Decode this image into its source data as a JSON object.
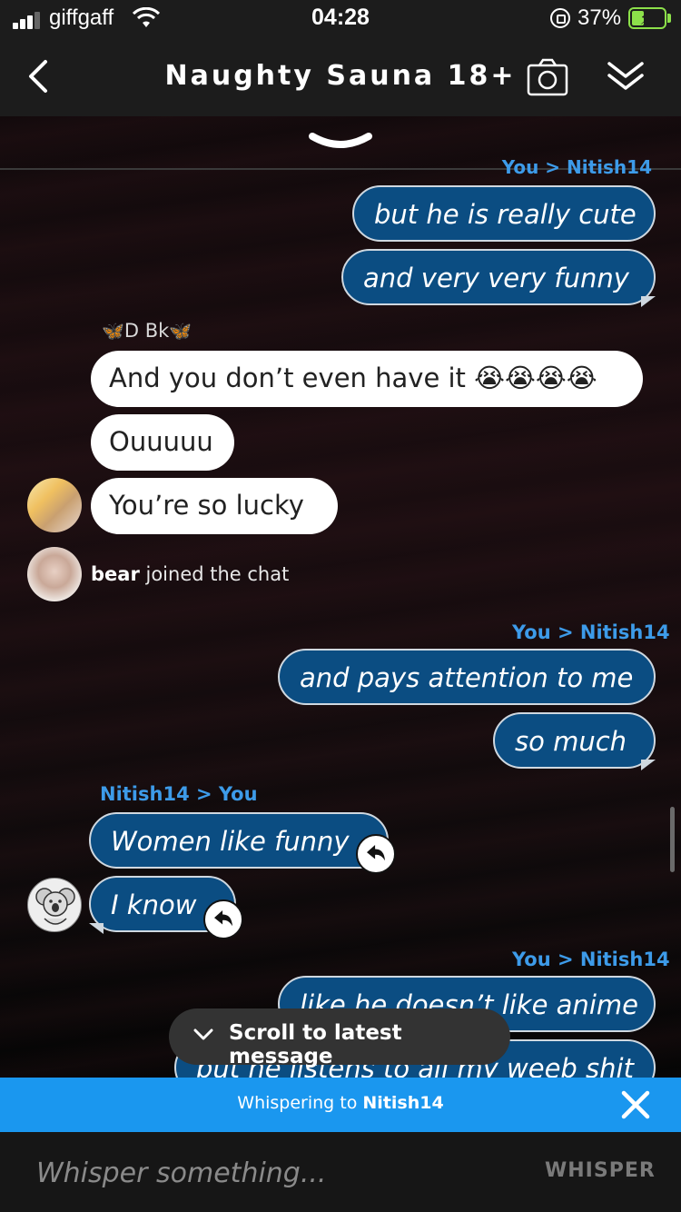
{
  "status_bar": {
    "carrier": "giffgaff",
    "time": "04:28",
    "battery_pct": "37%",
    "battery_level": 0.37
  },
  "header": {
    "title": "Naughty Sauna 18+",
    "back_icon": "chevron-left-icon",
    "camera_icon": "camera-icon",
    "collapse_icon": "double-chevron-down-icon"
  },
  "chat": {
    "cut_off_label": "You > Nitish14",
    "messages": [
      {
        "text": "but he is really cute"
      },
      {
        "text": "and very very funny"
      },
      {
        "sender": "D Bk",
        "text": "And you don’t even have it 😭😭😭😭"
      },
      {
        "text": "Ouuuuu"
      },
      {
        "text": "You’re so lucky"
      }
    ],
    "join_event": {
      "user": "bear",
      "text": " joined the chat"
    },
    "whisper_header_1": "You > Nitish14",
    "messages2": [
      {
        "text": "and pays attention to me"
      },
      {
        "text": "so much"
      }
    ],
    "whisper_header_2": "Nitish14 > You",
    "messages3": [
      {
        "text": "Women like funny"
      },
      {
        "text": "I know"
      }
    ],
    "whisper_header_3": "You > Nitish14",
    "messages4": [
      {
        "text": "like he doesn’t like anime"
      },
      {
        "text": "but he listens to all my weeb shit"
      }
    ]
  },
  "scroll_pill": {
    "label": "Scroll to latest message"
  },
  "whisper_banner": {
    "prefix": "Whispering to ",
    "target": "Nitish14"
  },
  "input": {
    "placeholder": "Whisper something...",
    "send_label": "WHISPER"
  },
  "colors": {
    "accent": "#1a97ef",
    "whisper_bubble": "#0b4d82",
    "header_bg": "#1c1c1c"
  }
}
